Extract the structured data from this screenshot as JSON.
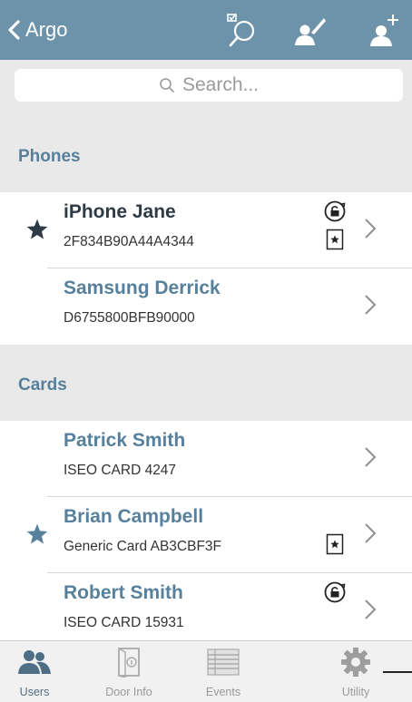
{
  "navbar": {
    "back_label": "Argo",
    "icons": [
      "search-check-icon",
      "edit-user-icon",
      "add-user-icon"
    ],
    "background": "#6c93aa"
  },
  "search": {
    "placeholder": "Search..."
  },
  "sections": {
    "phones": {
      "title": "Phones",
      "rows": [
        {
          "name": "iPhone Jane",
          "sub": "2F834B90A44A4344",
          "starred": true,
          "badges": [
            "lock-rotate-icon",
            "card-star-icon"
          ]
        },
        {
          "name": "Samsung Derrick",
          "sub": "D6755800BFB90000",
          "starred": false,
          "badges": []
        }
      ]
    },
    "cards": {
      "title": "Cards",
      "rows": [
        {
          "name": "Patrick Smith",
          "sub": "ISEO CARD 4247",
          "starred": false,
          "badges": []
        },
        {
          "name": "Brian Campbell",
          "sub": "Generic Card AB3CBF3F",
          "starred": true,
          "badges": [
            "card-star-icon"
          ]
        },
        {
          "name": "Robert Smith",
          "sub": "ISEO CARD 15931",
          "starred": false,
          "badges": [
            "lock-rotate-icon"
          ]
        }
      ]
    }
  },
  "tabbar": {
    "tabs": [
      {
        "label": "Users",
        "icon": "users-icon",
        "active": true
      },
      {
        "label": "Door Info",
        "icon": "door-icon",
        "active": false
      },
      {
        "label": "Events",
        "icon": "events-list-icon",
        "active": false
      },
      {
        "label": "Utility",
        "icon": "gear-icon",
        "active": false
      }
    ]
  },
  "colors": {
    "accent": "#57809c",
    "dark_text": "#2e3a45",
    "section_bg": "#e9e9e9"
  }
}
